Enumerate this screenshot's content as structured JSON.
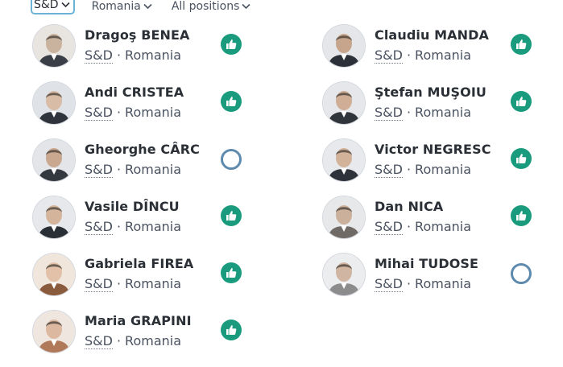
{
  "filters": {
    "group": "S&D",
    "country": "Romania",
    "position": "All positions"
  },
  "colors": {
    "for": "#1a9b7e",
    "did_not_vote": "#5e8aae",
    "active_filter_border": "#6db3d8"
  },
  "members_left": [
    {
      "name": "Dragoş BENEA",
      "group": "S&D",
      "country": "Romania",
      "vote": "for",
      "vote_icon": "thumbs-up-icon"
    },
    {
      "name": "Andi CRISTEA",
      "group": "S&D",
      "country": "Romania",
      "vote": "for",
      "vote_icon": "thumbs-up-icon"
    },
    {
      "name": "Gheorghe CÂRCIU",
      "group": "S&D",
      "country": "Romania",
      "vote": "did_not_vote",
      "vote_icon": "empty-circle-icon"
    },
    {
      "name": "Vasile DÎNCU",
      "group": "S&D",
      "country": "Romania",
      "vote": "for",
      "vote_icon": "thumbs-up-icon"
    },
    {
      "name": "Gabriela FIREA",
      "group": "S&D",
      "country": "Romania",
      "vote": "for",
      "vote_icon": "thumbs-up-icon"
    },
    {
      "name": "Maria GRAPINI",
      "group": "S&D",
      "country": "Romania",
      "vote": "for",
      "vote_icon": "thumbs-up-icon"
    }
  ],
  "members_right": [
    {
      "name": "Claudiu MANDA",
      "group": "S&D",
      "country": "Romania",
      "vote": "for",
      "vote_icon": "thumbs-up-icon"
    },
    {
      "name": "Ştefan MUŞOIU",
      "group": "S&D",
      "country": "Romania",
      "vote": "for",
      "vote_icon": "thumbs-up-icon"
    },
    {
      "name": "Victor NEGRESCU",
      "group": "S&D",
      "country": "Romania",
      "vote": "for",
      "vote_icon": "thumbs-up-icon"
    },
    {
      "name": "Dan NICA",
      "group": "S&D",
      "country": "Romania",
      "vote": "for",
      "vote_icon": "thumbs-up-icon"
    },
    {
      "name": "Mihai TUDOSE",
      "group": "S&D",
      "country": "Romania",
      "vote": "did_not_vote",
      "vote_icon": "empty-circle-icon"
    }
  ],
  "separator": "·"
}
